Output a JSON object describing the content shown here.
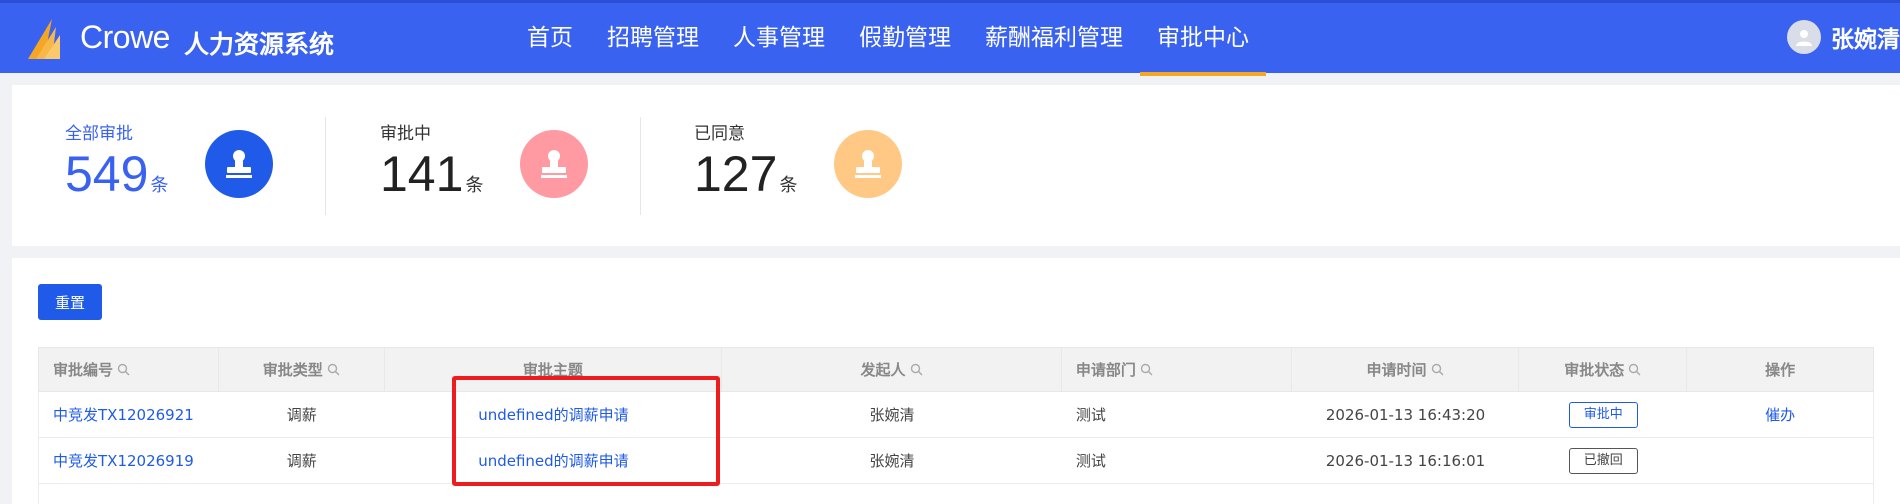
{
  "header": {
    "brand": "Crowe",
    "system_name": "人力资源系统",
    "nav": [
      {
        "label": "首页"
      },
      {
        "label": "招聘管理"
      },
      {
        "label": "人事管理"
      },
      {
        "label": "假勤管理"
      },
      {
        "label": "薪酬福利管理"
      },
      {
        "label": "审批中心",
        "active": true
      }
    ],
    "user_name": "张婉清"
  },
  "summary": {
    "all": {
      "label": "全部审批",
      "count": "549",
      "unit": "条",
      "color": "#3a62f0"
    },
    "in_progress": {
      "label": "审批中",
      "count": "141",
      "unit": "条",
      "color": "#ff9aa2"
    },
    "approved": {
      "label": "已同意",
      "count": "127",
      "unit": "条",
      "color": "#ffc985"
    }
  },
  "toolbar": {
    "reset_label": "重置"
  },
  "table": {
    "columns": [
      {
        "label": "审批编号",
        "searchable": true
      },
      {
        "label": "审批类型",
        "searchable": true
      },
      {
        "label": "审批主题",
        "searchable": false
      },
      {
        "label": "发起人",
        "searchable": true
      },
      {
        "label": "申请部门",
        "searchable": true
      },
      {
        "label": "申请时间",
        "searchable": true
      },
      {
        "label": "审批状态",
        "searchable": true
      },
      {
        "label": "操作",
        "searchable": false
      }
    ],
    "rows": [
      {
        "id": "中竞发TX12026921",
        "type": "调薪",
        "subject": "undefined的调薪申请",
        "initiator": "张婉清",
        "dept": "测试",
        "time": "2026-01-13 16:43:20",
        "status": "审批中",
        "action": "催办"
      },
      {
        "id": "中竞发TX12026919",
        "type": "调薪",
        "subject": "undefined的调薪申请",
        "initiator": "张婉清",
        "dept": "测试",
        "time": "2026-01-13 16:16:01",
        "status": "已撤回",
        "action": ""
      }
    ]
  },
  "colors": {
    "header_bg": "#3a62f0",
    "accent": "#1f5be8",
    "nav_active": "#f5a623",
    "highlight": "#ee1c1c"
  }
}
